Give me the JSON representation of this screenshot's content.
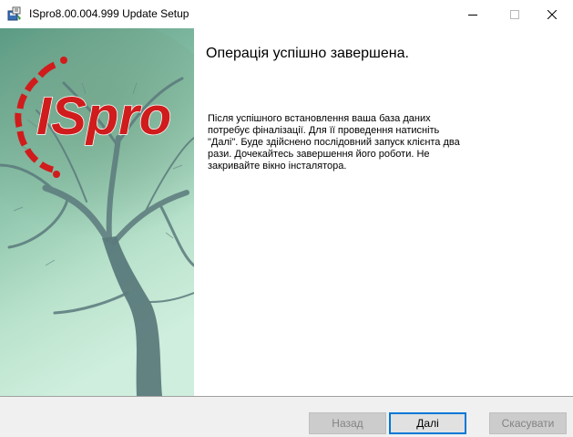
{
  "window": {
    "title": "ISpro8.00.004.999 Update Setup",
    "icon": "installer-icon"
  },
  "sidebar": {
    "logo_text": "ISpro",
    "logo_color": "#d01c1c"
  },
  "main": {
    "heading": "Операція успішно завершена.",
    "body_lines": [
      "Після успішного встановлення ваша база даних",
      "потребує фіналізації. Для її проведення натисніть",
      "\"Далі\". Буде здійснено послідовний запуск клієнта два",
      "рази. Дочекайтесь завершення його роботи. Не",
      "закривайте вікно інсталятора."
    ]
  },
  "buttons": {
    "back_label": "Назад",
    "next_label": "Далі",
    "cancel_label": "Скасувати"
  },
  "colors": {
    "accent": "#0078d7",
    "disabled_text": "#838383"
  }
}
